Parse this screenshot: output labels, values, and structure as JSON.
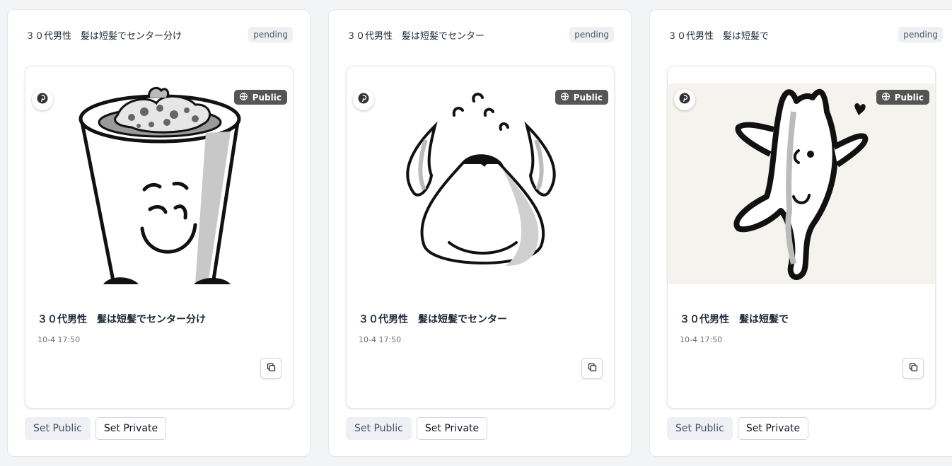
{
  "cards": [
    {
      "title": "３０代男性　髪は短髪でセンター分け",
      "status": "pending",
      "visibility": "Public",
      "item_title": "３０代男性　髪は短髪でセンター分け",
      "time": "10-4 17:50",
      "set_public_label": "Set Public",
      "set_private_label": "Set Private"
    },
    {
      "title": "３０代男性　髪は短髪でセンター",
      "status": "pending",
      "visibility": "Public",
      "item_title": "３０代男性　髪は短髪でセンター",
      "time": "10-4 17:50",
      "set_public_label": "Set Public",
      "set_private_label": "Set Private"
    },
    {
      "title": "３０代男性　髪は短髪で",
      "status": "pending",
      "visibility": "Public",
      "item_title": "３０代男性　髪は短髪で",
      "time": "10-4 17:50",
      "set_public_label": "Set Public",
      "set_private_label": "Set Private"
    }
  ],
  "icons": {
    "pin": "pinterest-icon",
    "globe": "globe-icon",
    "copy": "copy-icon"
  },
  "colors": {
    "badge_bg": "#eef0f3",
    "visibility_bg": "#373737",
    "border": "#e5e7eb"
  }
}
